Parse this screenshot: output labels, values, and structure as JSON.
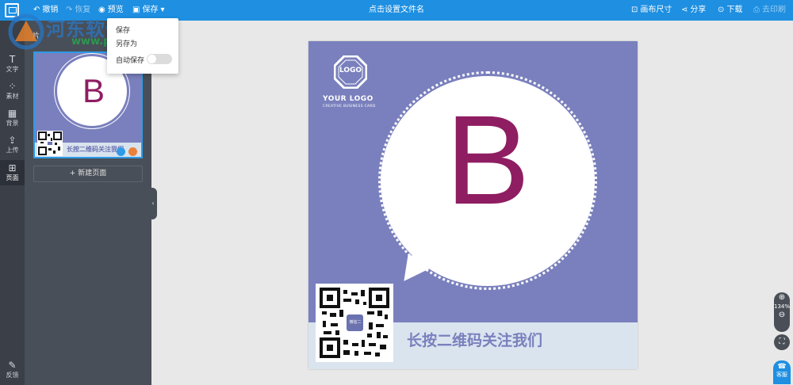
{
  "toolbar": {
    "undo": "撤销",
    "redo": "恢复",
    "preview": "预览",
    "save": "保存",
    "title": "点击设置文件名",
    "canvas_size": "画布尺寸",
    "share": "分享",
    "download": "下载",
    "print": "去印刷"
  },
  "save_menu": {
    "save": "保存",
    "save_as": "另存为",
    "autosave": "自动保存",
    "autosave_on": false
  },
  "rail": [
    {
      "icon": "text-icon",
      "glyph": "T",
      "label": "文字"
    },
    {
      "icon": "material-icon",
      "glyph": "⁘",
      "label": "素材"
    },
    {
      "icon": "background-icon",
      "glyph": "▦",
      "label": "背景"
    },
    {
      "icon": "upload-icon",
      "glyph": "⇪",
      "label": "上传"
    },
    {
      "icon": "page-icon",
      "glyph": "⊞",
      "label": "页面"
    },
    {
      "icon": "feedback-icon",
      "glyph": "✎",
      "label": "反馈"
    }
  ],
  "panel": {
    "head": "片",
    "new_page": "新建页面"
  },
  "card": {
    "logo_mark": "LOGO",
    "logo_text": "YOUR LOGO",
    "logo_sub": "CREATIVE BUSINESS CARD",
    "letter": "B",
    "qr_center": "微信二",
    "caption": "长按二维码关注我们"
  },
  "zoom": {
    "level": "134%"
  },
  "service": "客服",
  "watermark": {
    "text": "河东软件园",
    "url": "www.pc0359.cn"
  },
  "colors": {
    "topbar": "#1e8fe1",
    "card_bg": "#7a80bd",
    "letter": "#8f1d62",
    "footer_band": "#dae4ef"
  }
}
